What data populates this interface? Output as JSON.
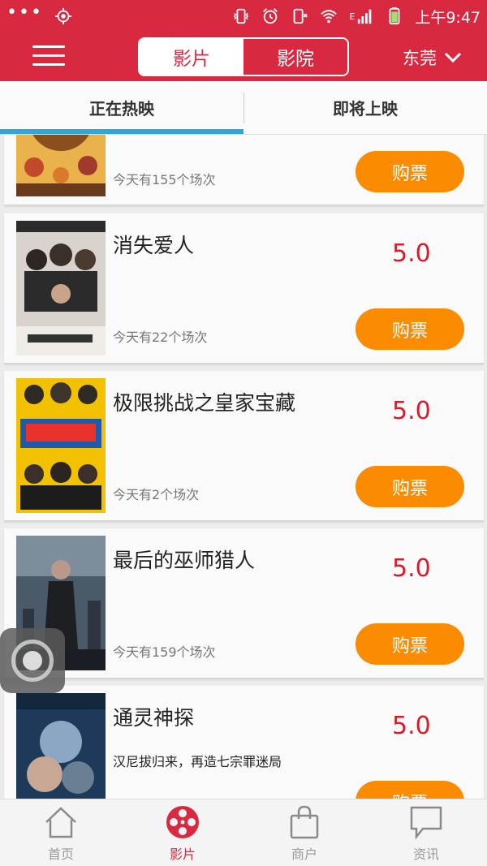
{
  "statusbar": {
    "time": "上午9:47",
    "network": "E"
  },
  "header": {
    "tabs": [
      "影片",
      "影院"
    ],
    "active_tab": "影片",
    "city": "东莞"
  },
  "subtabs": {
    "items": [
      "正在热映",
      "即将上映"
    ],
    "active": "正在热映"
  },
  "movies": [
    {
      "title": "",
      "score": "",
      "desc": "",
      "sessions": "今天有155个场次",
      "buy_label": "购票"
    },
    {
      "title": "消失爱人",
      "score": "5.0",
      "desc": "",
      "sessions": "今天有22个场次",
      "buy_label": "购票"
    },
    {
      "title": "极限挑战之皇家宝藏",
      "score": "5.0",
      "desc": "",
      "sessions": "今天有2个场次",
      "buy_label": "购票"
    },
    {
      "title": "最后的巫师猎人",
      "score": "5.0",
      "desc": "",
      "sessions": "今天有159个场次",
      "buy_label": "购票"
    },
    {
      "title": "通灵神探",
      "score": "5.0",
      "desc": "汉尼拔归来，再造七宗罪迷局",
      "sessions": "",
      "buy_label": "购票"
    }
  ],
  "bottom_nav": {
    "items": [
      {
        "label": "首页",
        "icon": "home-icon"
      },
      {
        "label": "影片",
        "icon": "film-reel-icon"
      },
      {
        "label": "商户",
        "icon": "shopping-bag-icon"
      },
      {
        "label": "资讯",
        "icon": "chat-bubble-icon"
      }
    ],
    "active": "影片"
  },
  "colors": {
    "brand_red": "#d92941",
    "buy_orange": "#fb8b00",
    "score_red": "#d41c2b",
    "tab_indicator": "#2fa7dd"
  }
}
